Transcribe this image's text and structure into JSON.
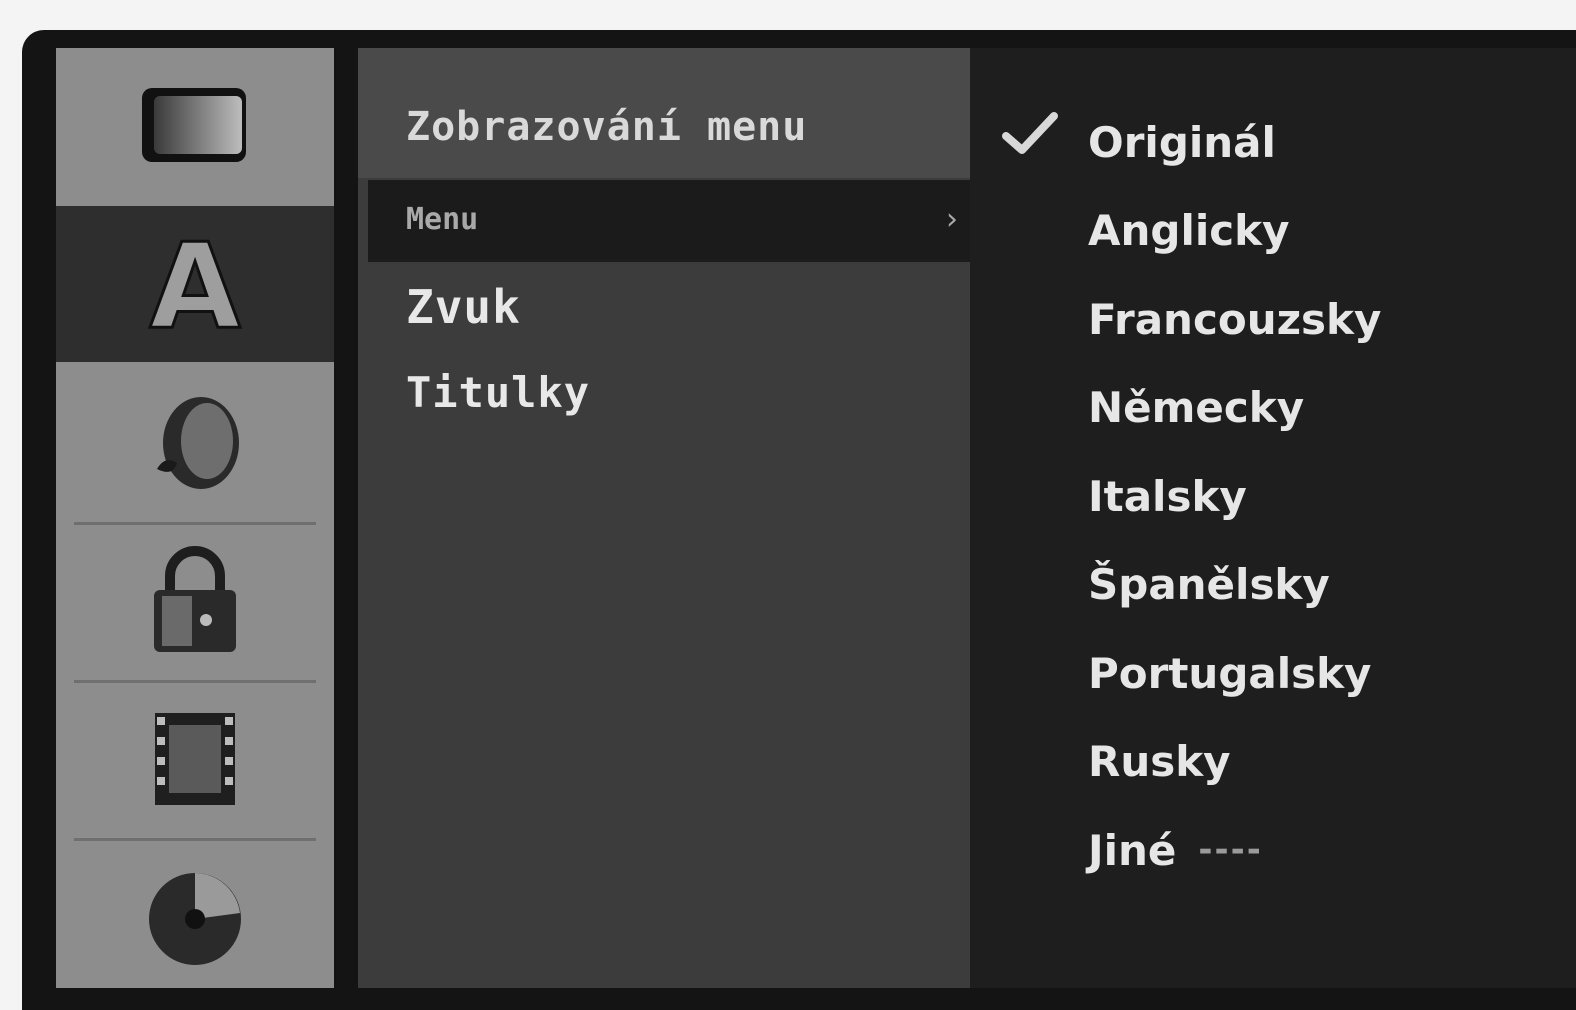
{
  "sidebar": {
    "icons": [
      {
        "name": "tv-screen-icon"
      },
      {
        "name": "language-a-icon",
        "label": "A",
        "active": true
      },
      {
        "name": "speaker-audio-icon"
      },
      {
        "name": "lock-icon"
      },
      {
        "name": "film-clapper-icon"
      },
      {
        "name": "disc-icon"
      }
    ]
  },
  "menu": {
    "title": "Zobrazování menu",
    "submenu": "Menu",
    "submenu_arrow": "›",
    "items": [
      "Zvuk",
      "Titulky"
    ]
  },
  "options": {
    "selected_index": 0,
    "items": [
      "Originál",
      "Anglicky",
      "Francouzsky",
      "Německy",
      "Italsky",
      "Španělsky",
      "Portugalsky",
      "Rusky",
      "Jiné"
    ],
    "other_code_placeholder": "----"
  },
  "colors": {
    "frame": "#141414",
    "icon_column": "#8d8d8d",
    "menu_panel": "#3c3c3c",
    "menu_header": "#4a4a4a",
    "highlight_row": "#1b1b1b",
    "option_panel": "#1e1e1e",
    "text": "#e6e6e6"
  }
}
